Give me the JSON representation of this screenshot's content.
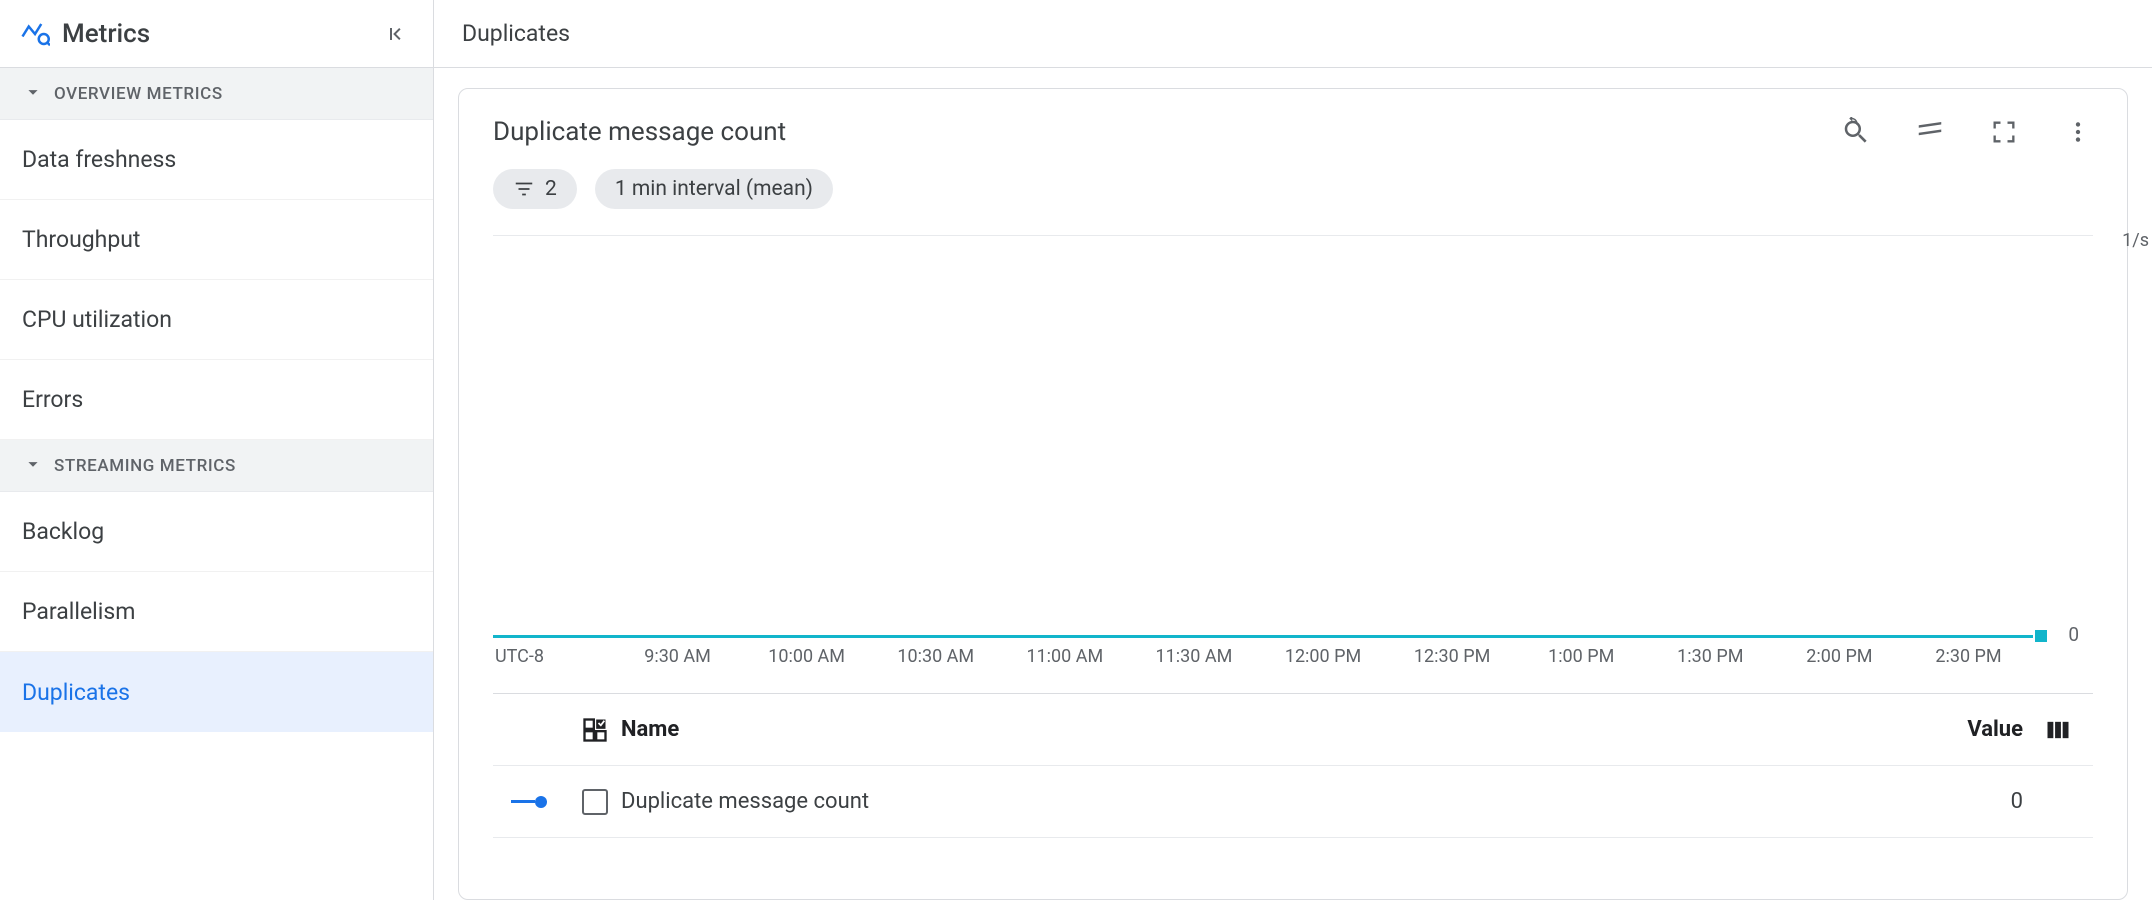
{
  "sidebar": {
    "title": "Metrics",
    "sections": [
      {
        "label": "OVERVIEW METRICS",
        "items": [
          "Data freshness",
          "Throughput",
          "CPU utilization",
          "Errors"
        ]
      },
      {
        "label": "STREAMING METRICS",
        "items": [
          "Backlog",
          "Parallelism",
          "Duplicates"
        ]
      }
    ],
    "active": "Duplicates"
  },
  "main": {
    "header_title": "Duplicates",
    "card": {
      "title": "Duplicate message count",
      "filter_chip_count": "2",
      "interval_chip": "1 min interval (mean)",
      "y_unit": "1/s",
      "y_zero": "0",
      "legend": {
        "name_header": "Name",
        "value_header": "Value",
        "series_name": "Duplicate message count",
        "series_value": "0"
      }
    }
  },
  "chart_data": {
    "type": "line",
    "title": "Duplicate message count",
    "ylabel": "1/s",
    "ylim": [
      0,
      1
    ],
    "tz": "UTC-8",
    "x_labels": [
      "9:30 AM",
      "10:00 AM",
      "10:30 AM",
      "11:00 AM",
      "11:30 AM",
      "12:00 PM",
      "12:30 PM",
      "1:00 PM",
      "1:30 PM",
      "2:00 PM",
      "2:30 PM"
    ],
    "series": [
      {
        "name": "Duplicate message count",
        "color": "#12b5cb",
        "value": 0,
        "values": [
          0,
          0,
          0,
          0,
          0,
          0,
          0,
          0,
          0,
          0,
          0
        ]
      }
    ]
  }
}
